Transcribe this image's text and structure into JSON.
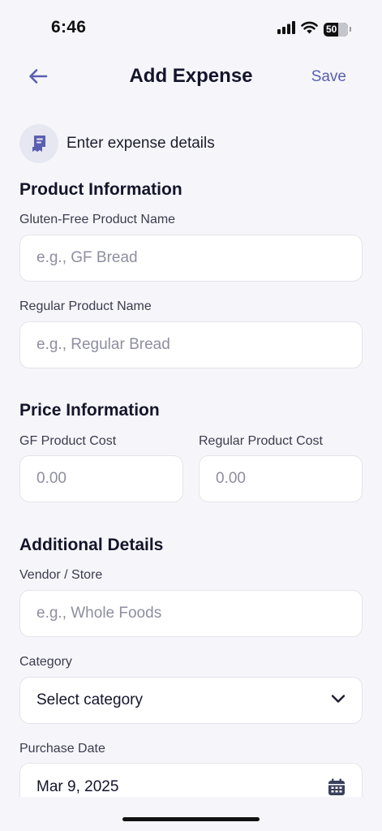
{
  "status": {
    "time": "6:46",
    "battery": "50"
  },
  "nav": {
    "title": "Add Expense",
    "save_label": "Save",
    "back_icon": "arrow-left-icon"
  },
  "intro": {
    "icon": "receipt-icon",
    "text": "Enter expense details"
  },
  "product_info": {
    "title": "Product Information",
    "gf_name_label": "Gluten-Free Product Name",
    "gf_name_placeholder": "e.g., GF Bread",
    "gf_name_value": "",
    "regular_name_label": "Regular Product Name",
    "regular_name_placeholder": "e.g., Regular Bread",
    "regular_name_value": ""
  },
  "price_info": {
    "title": "Price Information",
    "gf_cost_label": "GF Product Cost",
    "gf_cost_placeholder": "0.00",
    "regular_cost_label": "Regular Product Cost",
    "regular_cost_placeholder": "0.00"
  },
  "additional": {
    "title": "Additional Details",
    "vendor_label": "Vendor / Store",
    "vendor_placeholder": "e.g., Whole Foods",
    "category_label": "Category",
    "category_value": "Select category",
    "date_label": "Purchase Date",
    "date_value": "Mar 9, 2025"
  },
  "colors": {
    "accent": "#5b5fb0",
    "background": "#f6f6fa",
    "field_border": "#e3e3ea",
    "text": "#14142b"
  }
}
